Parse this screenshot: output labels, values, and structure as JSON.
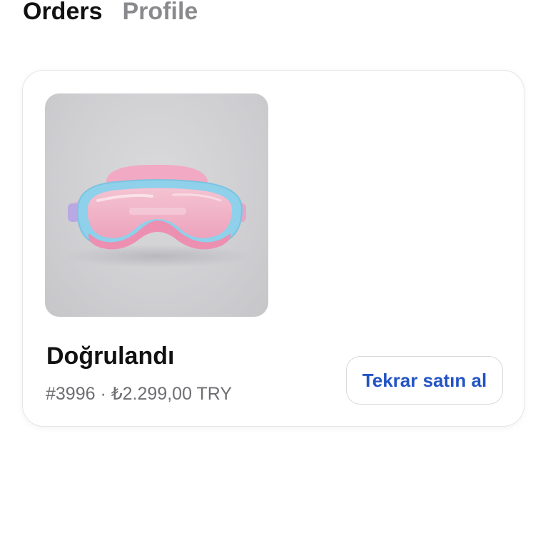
{
  "tabs": [
    {
      "label": "Orders",
      "active": true
    },
    {
      "label": "Profile",
      "active": false
    }
  ],
  "order": {
    "status": "Doğrulandı",
    "number": "#3996",
    "separator": " · ",
    "price": "₺2.299,00 TRY",
    "buy_again_label": "Tekrar satın al",
    "image_subject": "swim-goggles"
  },
  "colors": {
    "accent": "#2354c4",
    "secondary_text": "#6e6e73",
    "inactive_tab": "#8a8a8e",
    "goggle_frame": "#8fd0ea",
    "goggle_strap": "#f3a9c4"
  }
}
